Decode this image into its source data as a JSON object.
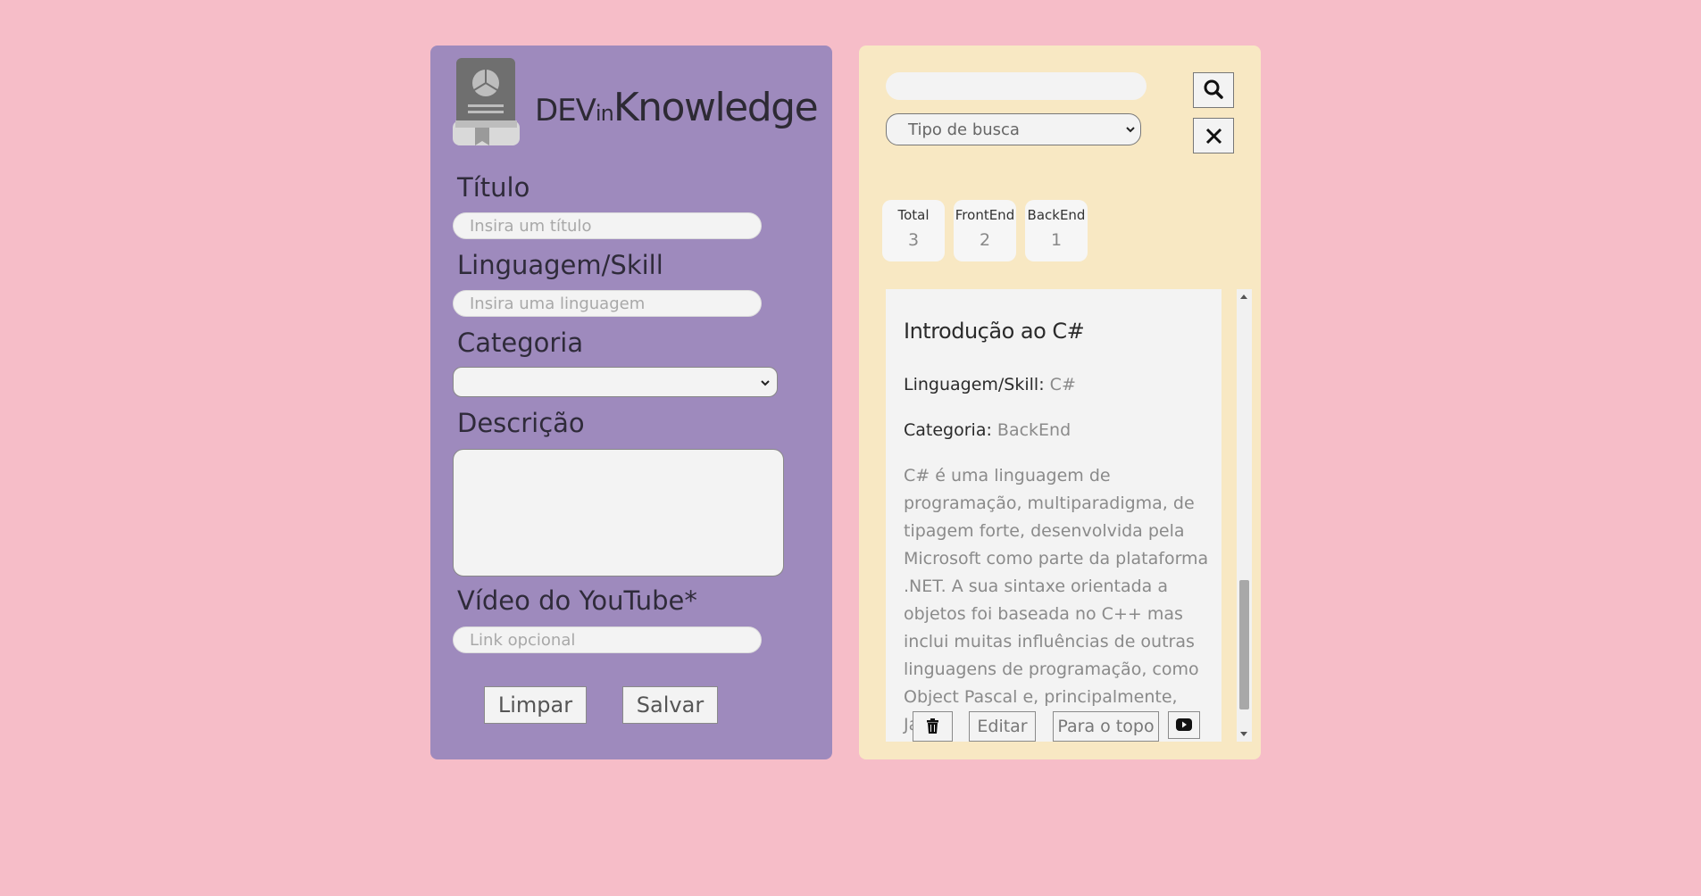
{
  "app": {
    "brand_dev": "DEV",
    "brand_in": "in",
    "brand_knowledge": "Knowledge"
  },
  "form": {
    "title_label": "Título",
    "title_placeholder": "Insira um título",
    "language_label": "Linguagem/Skill",
    "language_placeholder": "Insira uma linguagem",
    "category_label": "Categoria",
    "category_value": "",
    "description_label": "Descrição",
    "description_value": "",
    "video_label": "Vídeo do YouTube*",
    "video_placeholder": "Link opcional",
    "clear_button": "Limpar",
    "save_button": "Salvar"
  },
  "search": {
    "value": "",
    "type_placeholder": "Tipo de busca",
    "search_icon": "search-icon",
    "close_icon": "close-icon"
  },
  "stats": [
    {
      "label": "Total",
      "value": "3"
    },
    {
      "label": "FrontEnd",
      "value": "2"
    },
    {
      "label": "BackEnd",
      "value": "1"
    }
  ],
  "card": {
    "title": "Introdução ao C#",
    "language_key": "Linguagem/Skill:",
    "language_value": "C#",
    "category_key": "Categoria:",
    "category_value": "BackEnd",
    "description": "C# é uma linguagem de programação, multiparadigma, de tipagem forte, desenvolvida pela Microsoft como parte da plataforma .NET. A sua sintaxe orientada a objetos foi baseada no C++ mas inclui muitas influências de outras linguagens de programação, como Object Pascal e, principalmente, Java.",
    "edit_button": "Editar",
    "top_button": "Para o topo",
    "delete_icon": "trash-icon",
    "video_icon": "youtube-icon"
  },
  "colors": {
    "background": "#f6bdc8",
    "form_panel": "#9e8abd",
    "list_panel": "#f8e8c3"
  }
}
